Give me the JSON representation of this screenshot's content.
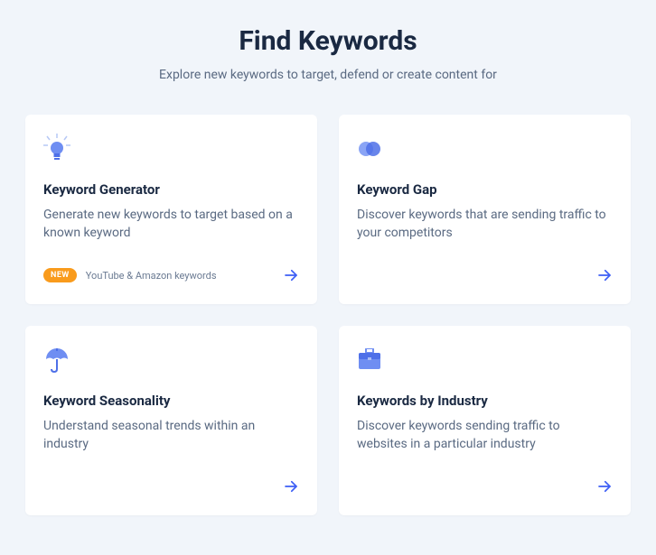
{
  "header": {
    "title": "Find Keywords",
    "subtitle": "Explore new keywords to target, defend or create content for"
  },
  "cards": [
    {
      "icon": "lightbulb-icon",
      "title": "Keyword Generator",
      "description": "Generate new keywords to target based on a known keyword",
      "badge": "NEW",
      "footer_text": "YouTube & Amazon keywords"
    },
    {
      "icon": "overlap-circles-icon",
      "title": "Keyword Gap",
      "description": "Discover keywords that are sending traffic to your competitors",
      "badge": null,
      "footer_text": null
    },
    {
      "icon": "umbrella-icon",
      "title": "Keyword Seasonality",
      "description": "Understand seasonal trends within an industry",
      "badge": null,
      "footer_text": null
    },
    {
      "icon": "briefcase-icon",
      "title": "Keywords by Industry",
      "description": "Discover keywords sending traffic to websites in a particular industry",
      "badge": null,
      "footer_text": null
    }
  ]
}
